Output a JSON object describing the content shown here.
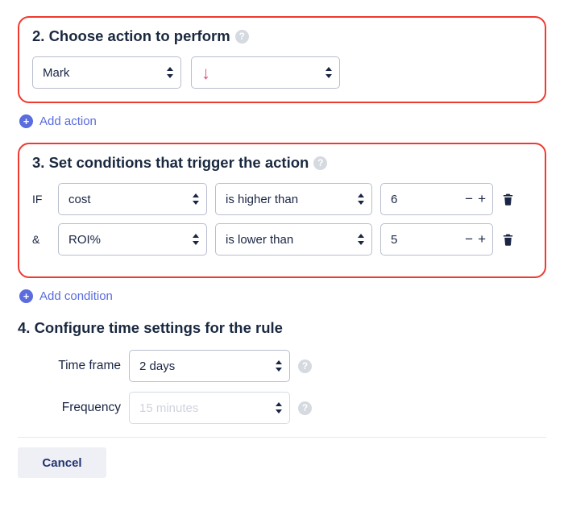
{
  "section2": {
    "title": "2. Choose action to perform",
    "action_select": "Mark",
    "direction_icon": "arrow-down-icon",
    "add_label": "Add action"
  },
  "section3": {
    "title": "3. Set conditions that trigger the action",
    "rows": [
      {
        "prefix": "IF",
        "metric": "cost",
        "op": "is higher than",
        "value": "6"
      },
      {
        "prefix": "&",
        "metric": "ROI%",
        "op": "is lower than",
        "value": "5"
      }
    ],
    "add_label": "Add condition"
  },
  "section4": {
    "title": "4. Configure time settings for the rule",
    "timeframe_label": "Time frame",
    "timeframe_value": "2 days",
    "frequency_label": "Frequency",
    "frequency_value": "15 minutes"
  },
  "footer": {
    "cancel": "Cancel"
  },
  "glyphs": {
    "help": "?",
    "plus": "+",
    "minus": "−",
    "pluschar": "+"
  }
}
